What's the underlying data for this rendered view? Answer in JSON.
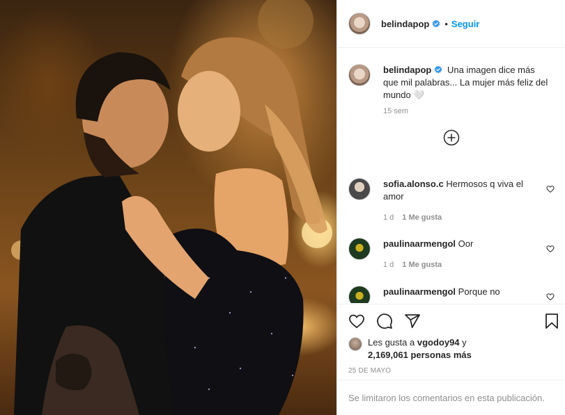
{
  "post": {
    "username": "belindapop",
    "follow_label": "Seguir",
    "dot": "•"
  },
  "caption": {
    "username": "belindapop",
    "text": "Una imagen dice más que mil palabras... La mujer más feliz del mundo 🤍",
    "time": "15 sem"
  },
  "comments": [
    {
      "username": "sofia.alonso.c",
      "text": "Hermosos q viva el amor",
      "time": "1 d",
      "likes": "1 Me gusta"
    },
    {
      "username": "paulinaarmengol",
      "text": "Oor",
      "time": "1 d",
      "likes": "1 Me gusta"
    },
    {
      "username": "paulinaarmengol",
      "text": "Porque no"
    }
  ],
  "likes": {
    "prefix": "Les gusta a",
    "user": "vgodoy94",
    "and": "y",
    "count": "2,169,061 personas más"
  },
  "date": "25 DE MAYO",
  "footer": "Se limitaron los comentarios en esta publicación.",
  "icons": [
    "verified-badge-icon",
    "add-circle-icon",
    "heart-icon",
    "comment-icon",
    "share-icon",
    "bookmark-icon"
  ],
  "colors": {
    "accent": "#0095f6",
    "muted": "#8e8e8e",
    "text": "#262626",
    "border": "#efefef"
  }
}
